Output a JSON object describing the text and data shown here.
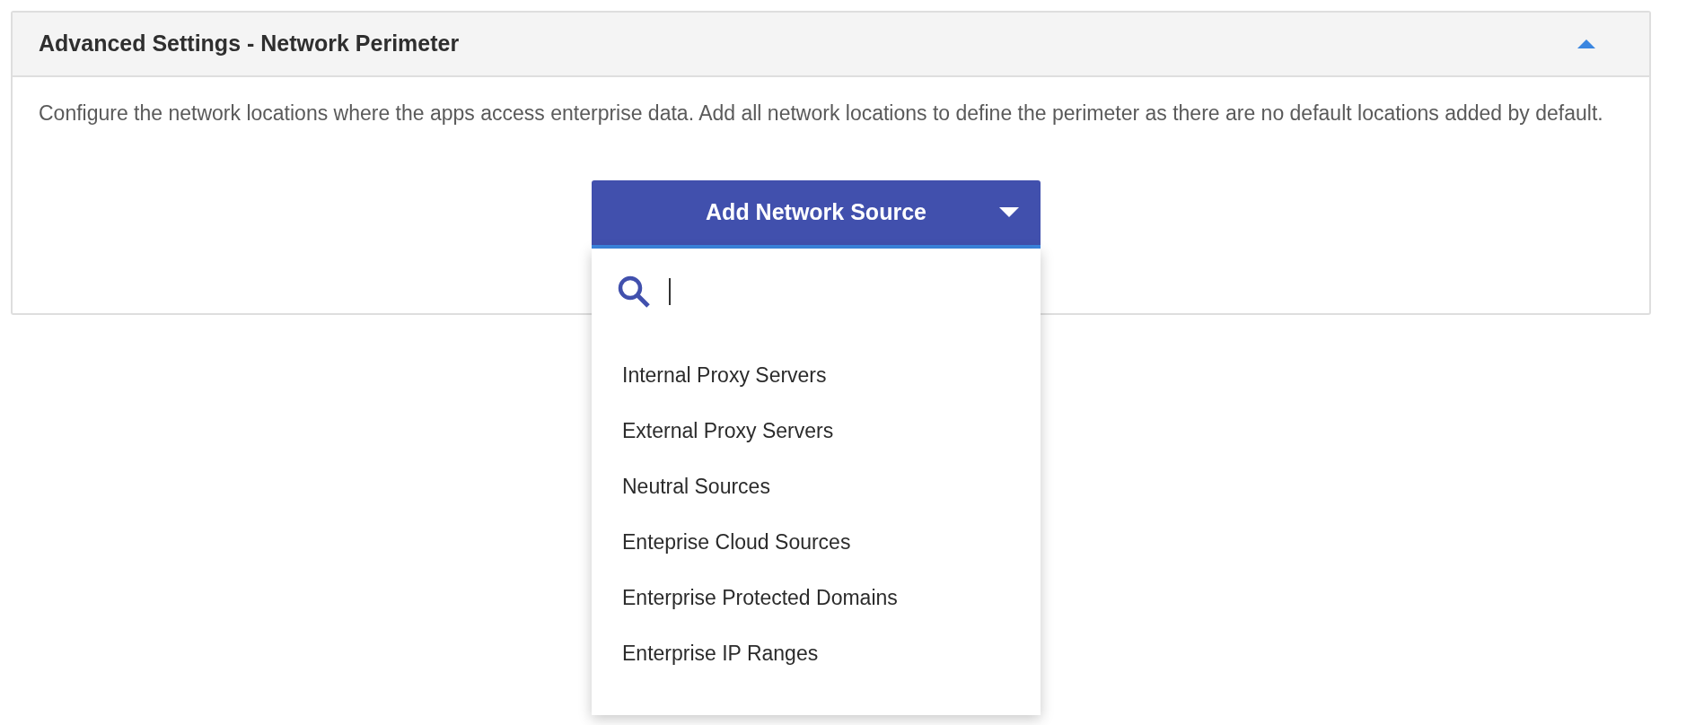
{
  "panel": {
    "title": "Advanced Settings - Network Perimeter",
    "expanded": true,
    "description": "Configure the network locations where the apps access enterprise data. Add all network locations to define the perimeter as there are no default locations added by default."
  },
  "add_button": {
    "label": "Add Network Source",
    "open": true
  },
  "dropdown": {
    "items": [
      {
        "label": "Internal Proxy Servers"
      },
      {
        "label": "External Proxy Servers"
      },
      {
        "label": "Neutral Sources"
      },
      {
        "label": "Enteprise Cloud Sources"
      },
      {
        "label": "Enterprise Protected Domains"
      },
      {
        "label": "Enterprise IP Ranges"
      }
    ]
  }
}
